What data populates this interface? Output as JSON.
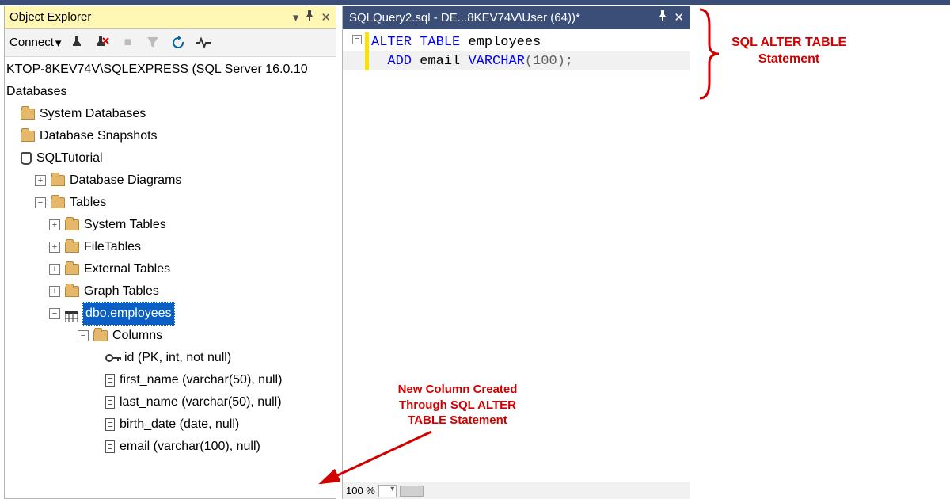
{
  "objectExplorer": {
    "title": "Object Explorer",
    "connect_label": "Connect",
    "server_line": "KTOP-8KEV74V\\SQLEXPRESS (SQL Server 16.0.10",
    "databases_label": "Databases",
    "sys_db": "System Databases",
    "db_snapshots": "Database Snapshots",
    "user_db": "SQLTutorial",
    "db_diagrams": "Database Diagrams",
    "tables": "Tables",
    "system_tables": "System Tables",
    "file_tables": "FileTables",
    "external_tables": "External Tables",
    "graph_tables": "Graph Tables",
    "dbo_employees": "dbo.employees",
    "columns": "Columns",
    "col_id": "id (PK, int, not null)",
    "col_first": "first_name (varchar(50), null)",
    "col_last": "last_name (varchar(50), null)",
    "col_birth": "birth_date (date, null)",
    "col_email": "email (varchar(100), null)"
  },
  "editor": {
    "tab_title": "SQLQuery2.sql - DE...8KEV74V\\User (64))*",
    "line1": {
      "kw1": "ALTER",
      "kw2": "TABLE",
      "ident": "employees"
    },
    "line2": {
      "kw": "ADD",
      "ident": "email",
      "type": "VARCHAR",
      "open": "(",
      "num": "100",
      "close": ")",
      "semi": ";"
    },
    "zoom": "100 %"
  },
  "annotations": {
    "right1": "SQL ALTER TABLE",
    "right2": "Statement",
    "center1": "New Column Created",
    "center2": "Through SQL ALTER",
    "center3": "TABLE Statement"
  }
}
